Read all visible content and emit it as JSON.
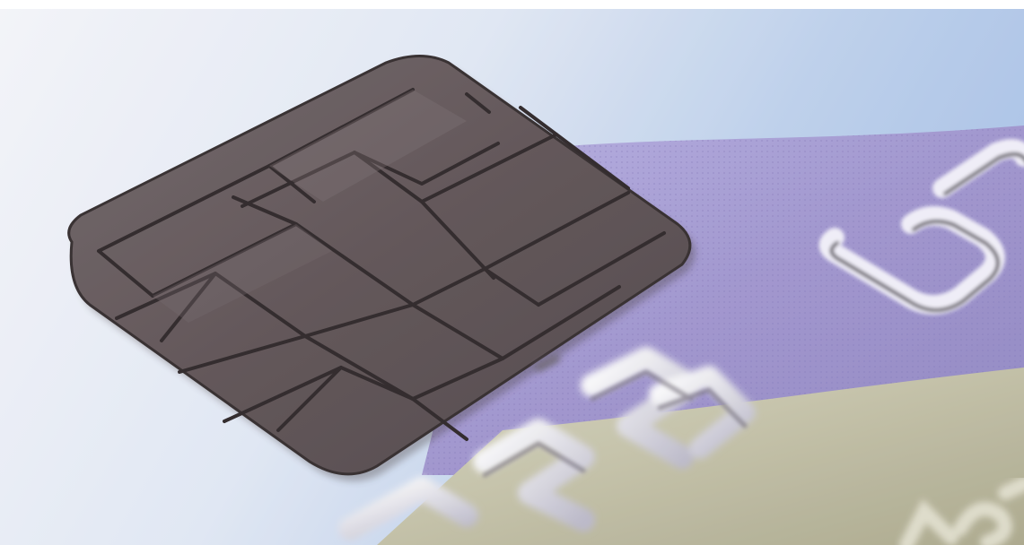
{
  "photo": {
    "subject": "credit-card-emv-chip",
    "printed_text": "",
    "colors": {
      "card_white": "#eef0f6",
      "card_blue": "#b8cbe9",
      "card_purple": "#9f95cf",
      "card_olive": "#c2c0a0",
      "chip_metal": "#5e5254",
      "chip_lines": "#2a2224",
      "emboss_highlight": "#f4f4f8"
    }
  }
}
